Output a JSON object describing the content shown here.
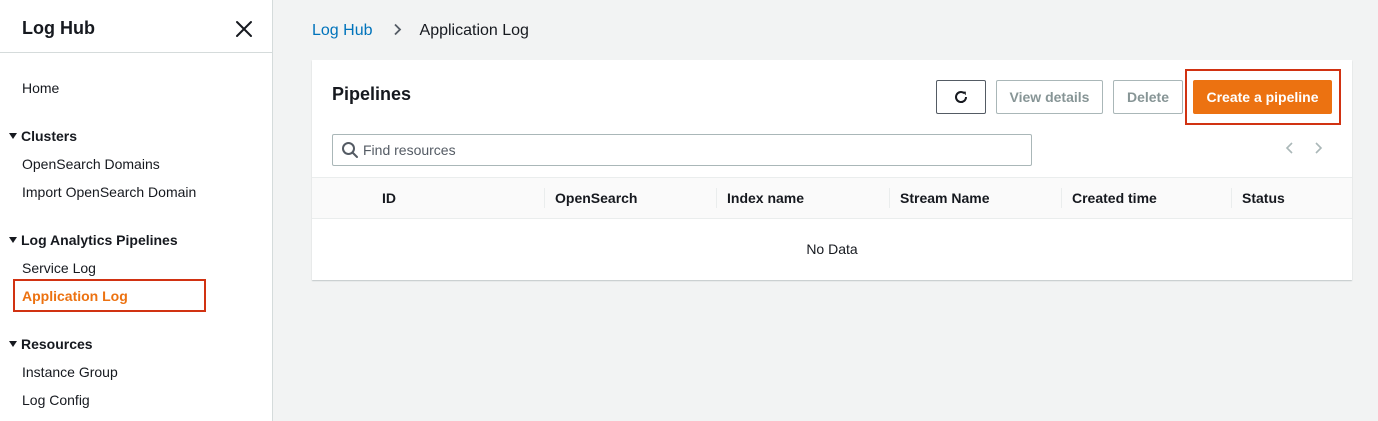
{
  "sidebar": {
    "title": "Log Hub",
    "home": "Home",
    "sections": [
      {
        "label": "Clusters",
        "items": [
          "OpenSearch Domains",
          "Import OpenSearch Domain"
        ]
      },
      {
        "label": "Log Analytics Pipelines",
        "items": [
          "Service Log",
          "Application Log"
        ]
      },
      {
        "label": "Resources",
        "items": [
          "Instance Group",
          "Log Config"
        ]
      }
    ],
    "active_item": "Application Log"
  },
  "breadcrumb": {
    "root": "Log Hub",
    "current": "Application Log"
  },
  "panel": {
    "title": "Pipelines",
    "buttons": {
      "refresh_icon": "refresh-icon",
      "view_details": "View details",
      "delete": "Delete",
      "create": "Create a pipeline"
    },
    "search": {
      "placeholder": "Find resources",
      "value": ""
    },
    "columns": [
      "ID",
      "OpenSearch",
      "Index name",
      "Stream Name",
      "Created time",
      "Status"
    ],
    "rows": [],
    "empty_text": "No Data"
  },
  "colors": {
    "accent": "#ec7211",
    "link": "#0073bb",
    "highlight": "#d13212"
  }
}
